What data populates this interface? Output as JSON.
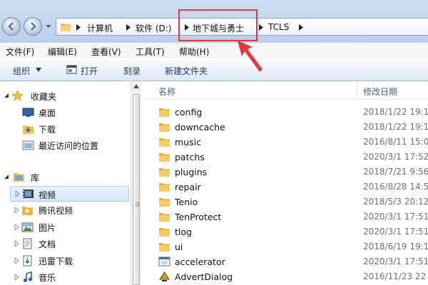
{
  "address": {
    "crumbs": [
      "计算机",
      "软件 (D:)",
      "地下城与勇士",
      "TCLS"
    ]
  },
  "menu": [
    "文件(F)",
    "编辑(E)",
    "查看(V)",
    "工具(T)",
    "帮助(H)"
  ],
  "toolbar": {
    "organize": "组织",
    "open": "打开",
    "burn": "刻录",
    "new_folder": "新建文件夹"
  },
  "nav": {
    "favorites": "收藏夹",
    "desktop": "桌面",
    "downloads": "下载",
    "recent": "最近访问的位置",
    "libraries": "库",
    "videos": "视频",
    "tencent_video": "腾讯视频",
    "pictures": "图片",
    "documents": "文档",
    "thunder": "迅雷下载",
    "music": "音乐"
  },
  "columns": {
    "name": "名称",
    "modified": "修改日期"
  },
  "files": [
    {
      "name": "config",
      "date": "2018/1/22 19:1",
      "icon": "folder-icon"
    },
    {
      "name": "downcache",
      "date": "2018/1/22 19:1",
      "icon": "folder-icon"
    },
    {
      "name": "music",
      "date": "2016/8/11 15:0",
      "icon": "folder-icon"
    },
    {
      "name": "patchs",
      "date": "2020/3/1 17:52",
      "icon": "folder-icon"
    },
    {
      "name": "plugins",
      "date": "2018/7/21 9:56",
      "icon": "folder-icon"
    },
    {
      "name": "repair",
      "date": "2016/8/28 14:5",
      "icon": "folder-icon"
    },
    {
      "name": "Tenio",
      "date": "2018/5/3 20:12",
      "icon": "folder-icon"
    },
    {
      "name": "TenProtect",
      "date": "2020/3/1 17:51",
      "icon": "folder-icon"
    },
    {
      "name": "tlog",
      "date": "2020/3/1 17:51",
      "icon": "folder-icon"
    },
    {
      "name": "ui",
      "date": "2018/6/19 19:1",
      "icon": "folder-icon"
    },
    {
      "name": "accelerator",
      "date": "2020/3/1 17:51",
      "icon": "exe-icon"
    },
    {
      "name": "AdvertDialog",
      "date": "2016/11/23 22",
      "icon": "exe-game-icon"
    }
  ],
  "colors": {
    "highlight": "#e2383b",
    "folder": "#f2c24f"
  }
}
